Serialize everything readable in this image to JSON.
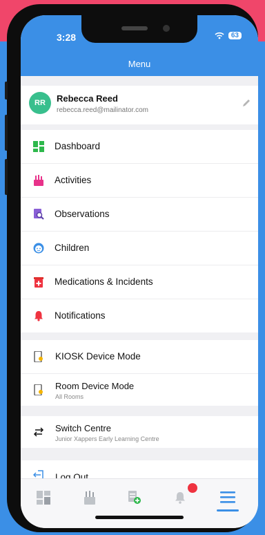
{
  "status_bar": {
    "time": "3:28",
    "battery": "63"
  },
  "header": {
    "title": "Menu"
  },
  "profile": {
    "initials": "RR",
    "name": "Rebecca Reed",
    "email": "rebecca.reed@mailinator.com"
  },
  "menu": {
    "main": [
      {
        "label": "Dashboard",
        "icon": "dashboard-icon"
      },
      {
        "label": "Activities",
        "icon": "activities-icon"
      },
      {
        "label": "Observations",
        "icon": "observations-icon"
      },
      {
        "label": "Children",
        "icon": "children-icon"
      },
      {
        "label": "Medications & Incidents",
        "icon": "medications-icon"
      },
      {
        "label": "Notifications",
        "icon": "bell-icon"
      }
    ],
    "modes": [
      {
        "label": "KIOSK Device Mode",
        "sub": ""
      },
      {
        "label": "Room Device Mode",
        "sub": "All Rooms"
      }
    ],
    "centre": {
      "label": "Switch Centre",
      "sub": "Junior Xappers Early Learning Centre"
    },
    "logout": {
      "label": "Log Out"
    }
  },
  "tabbar": {
    "items": [
      "dashboard-tab",
      "activities-tab",
      "add-observation-tab",
      "notifications-tab",
      "menu-tab"
    ],
    "active": "menu-tab"
  },
  "colors": {
    "primary": "#3b8fe6",
    "avatar": "#38bf8d",
    "alert": "#ef3340"
  }
}
